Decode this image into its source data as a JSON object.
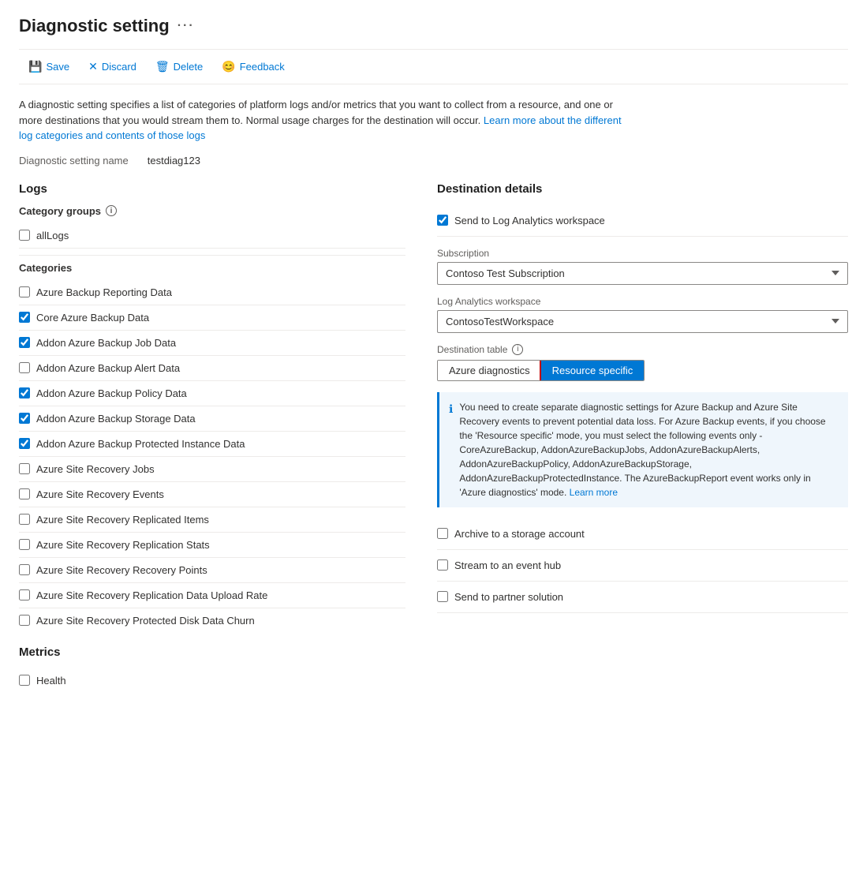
{
  "page": {
    "title": "Diagnostic setting",
    "ellipsis": "···"
  },
  "toolbar": {
    "save_label": "Save",
    "discard_label": "Discard",
    "delete_label": "Delete",
    "feedback_label": "Feedback"
  },
  "description": {
    "text1": "A diagnostic setting specifies a list of categories of platform logs and/or metrics that you want to collect from a resource, and one or more destinations that you would stream them to. Normal usage charges for the destination will occur.",
    "link_text": "Learn more about the different log categories and contents of those logs",
    "link_href": "#"
  },
  "setting_name": {
    "label": "Diagnostic setting name",
    "value": "testdiag123"
  },
  "logs": {
    "section_title": "Logs",
    "category_groups_label": "Category groups",
    "all_logs": {
      "label": "allLogs",
      "checked": false
    },
    "categories_label": "Categories",
    "categories": [
      {
        "label": "Azure Backup Reporting Data",
        "checked": false
      },
      {
        "label": "Core Azure Backup Data",
        "checked": true
      },
      {
        "label": "Addon Azure Backup Job Data",
        "checked": true
      },
      {
        "label": "Addon Azure Backup Alert Data",
        "checked": false
      },
      {
        "label": "Addon Azure Backup Policy Data",
        "checked": true
      },
      {
        "label": "Addon Azure Backup Storage Data",
        "checked": true
      },
      {
        "label": "Addon Azure Backup Protected Instance Data",
        "checked": true
      },
      {
        "label": "Azure Site Recovery Jobs",
        "checked": false
      },
      {
        "label": "Azure Site Recovery Events",
        "checked": false
      },
      {
        "label": "Azure Site Recovery Replicated Items",
        "checked": false
      },
      {
        "label": "Azure Site Recovery Replication Stats",
        "checked": false
      },
      {
        "label": "Azure Site Recovery Recovery Points",
        "checked": false
      },
      {
        "label": "Azure Site Recovery Replication Data Upload Rate",
        "checked": false
      },
      {
        "label": "Azure Site Recovery Protected Disk Data Churn",
        "checked": false
      }
    ]
  },
  "metrics": {
    "section_title": "Metrics",
    "items": [
      {
        "label": "Health",
        "checked": false
      }
    ]
  },
  "destination": {
    "section_title": "Destination details",
    "send_to_la": {
      "label": "Send to Log Analytics workspace",
      "checked": true
    },
    "subscription": {
      "label": "Subscription",
      "value": "Contoso Test Subscription",
      "options": [
        "Contoso Test Subscription"
      ]
    },
    "workspace": {
      "label": "Log Analytics workspace",
      "value": "ContosoTestWorkspace",
      "options": [
        "ContosoTestWorkspace"
      ]
    },
    "dest_table": {
      "label": "Destination table",
      "tab1": "Azure diagnostics",
      "tab2": "Resource specific",
      "active_tab": "tab2"
    },
    "info_box": {
      "text": "You need to create separate diagnostic settings for Azure Backup and Azure Site Recovery events to prevent potential data loss. For Azure Backup events, if you choose the 'Resource specific' mode, you must select the following events only - CoreAzureBackup, AddonAzureBackupJobs, AddonAzureBackupAlerts, AddonAzureBackupPolicy, AddonAzureBackupStorage, AddonAzureBackupProtectedInstance. The AzureBackupReport event works only in 'Azure diagnostics' mode.",
      "learn_more_text": "Learn more",
      "learn_more_href": "#"
    },
    "archive": {
      "label": "Archive to a storage account",
      "checked": false
    },
    "stream_event": {
      "label": "Stream to an event hub",
      "checked": false
    },
    "partner": {
      "label": "Send to partner solution",
      "checked": false
    }
  }
}
